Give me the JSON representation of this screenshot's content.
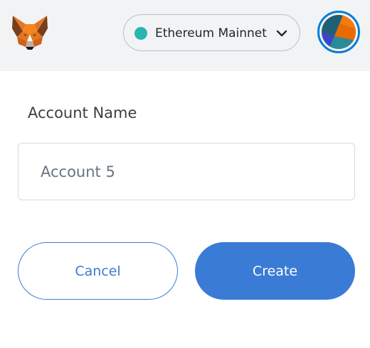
{
  "header": {
    "logo_icon": "metamask-fox-icon",
    "network": {
      "name": "Ethereum Mainnet",
      "dot_color": "#29b6af",
      "chevron_icon": "chevron-down-icon"
    },
    "account_icon": "account-identicon-icon",
    "account_ring_color": "#037dd6"
  },
  "form": {
    "label": "Account Name",
    "input_placeholder": "Account 5",
    "input_value": ""
  },
  "actions": {
    "cancel_label": "Cancel",
    "create_label": "Create",
    "accent_color": "#3a7bd5"
  }
}
